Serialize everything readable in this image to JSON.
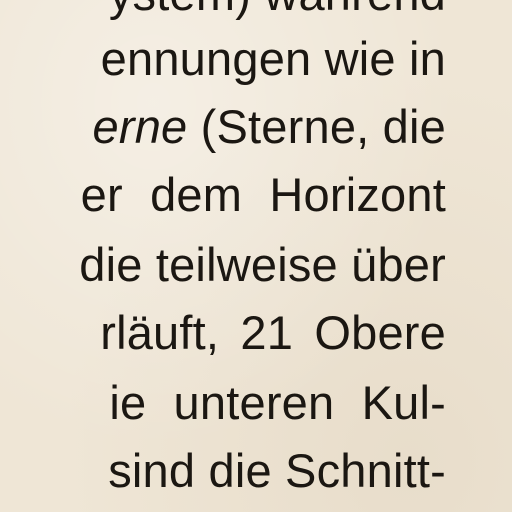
{
  "document": {
    "lines": [
      "ystem) während",
      "ennungen wie in",
      "erne (Sterne, die",
      "er dem Horizont",
      "die teilweise über",
      "rläuft, 21 Obere",
      "ie unteren Kul-",
      "sind die Schnitt-"
    ],
    "line3_italic_fragment": "erne",
    "line3_rest": " (Sterne, die"
  }
}
